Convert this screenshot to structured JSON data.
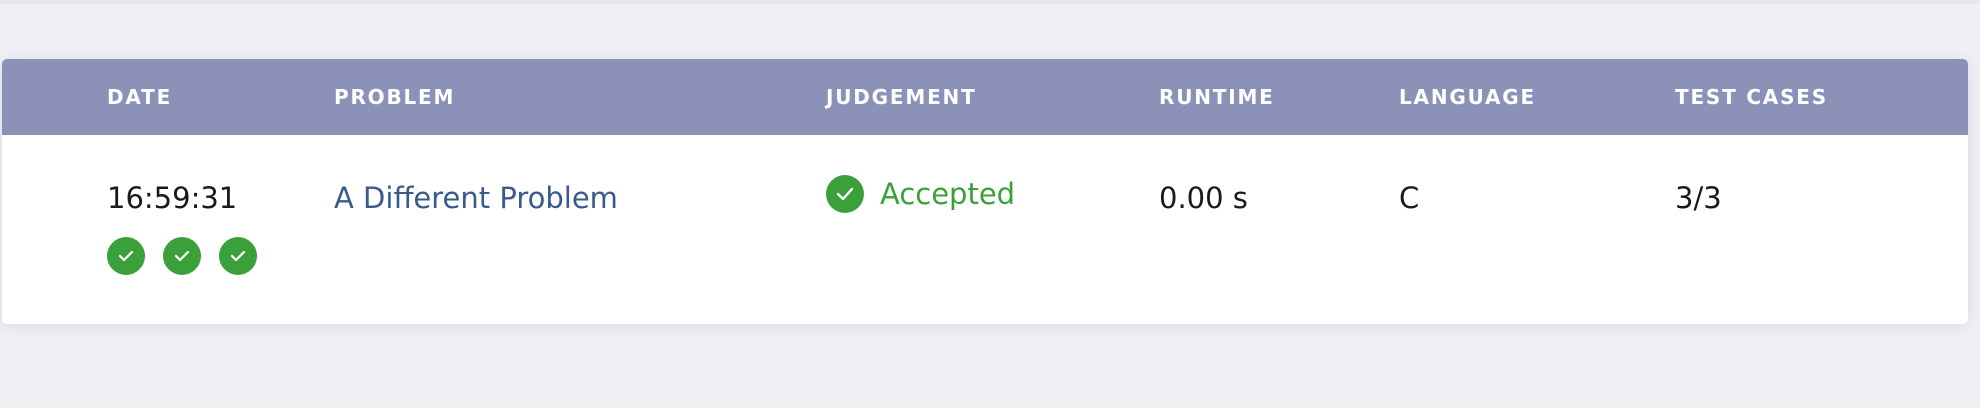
{
  "table": {
    "headers": {
      "date": "DATE",
      "problem": "PROBLEM",
      "judgement": "JUDGEMENT",
      "runtime": "RUNTIME",
      "language": "LANGUAGE",
      "test_cases": "TEST CASES"
    },
    "rows": [
      {
        "date": "16:59:31",
        "problem": "A Different Problem",
        "judgement": "Accepted",
        "judgement_icon": "check-circle-icon",
        "runtime": "0.00 s",
        "language": "C",
        "test_cases": "3/3",
        "test_results": [
          "passed",
          "passed",
          "passed"
        ]
      }
    ]
  },
  "colors": {
    "header_bg": "#8c91b8",
    "accepted": "#3aa03a",
    "link": "#3b5a8c"
  }
}
